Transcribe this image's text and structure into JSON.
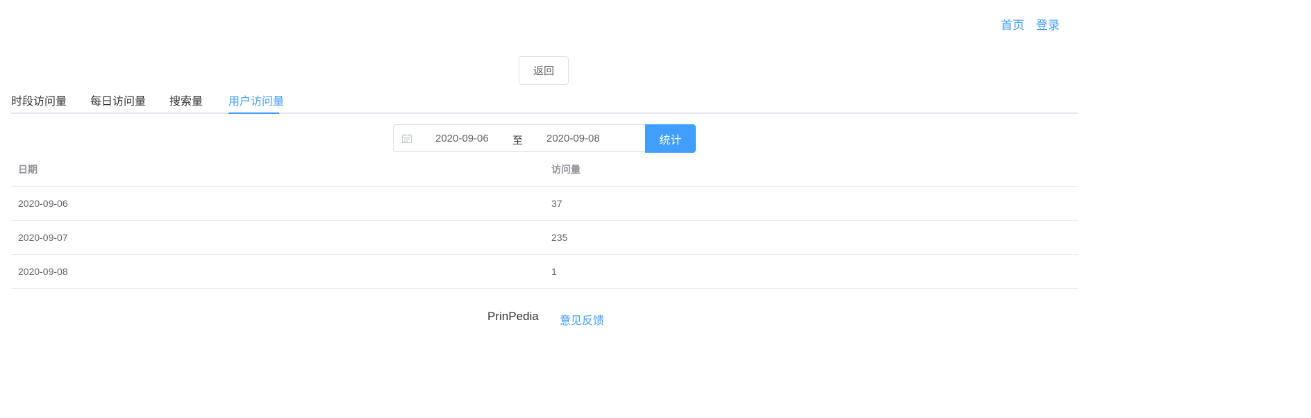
{
  "topnav": {
    "home": "首页",
    "login": "登录"
  },
  "back_button": "返回",
  "tabs": [
    {
      "label": "时段访问量",
      "active": false
    },
    {
      "label": "每日访问量",
      "active": false
    },
    {
      "label": "搜索量",
      "active": false
    },
    {
      "label": "用户访问量",
      "active": true
    }
  ],
  "date_range": {
    "icon": "calendar-icon",
    "start": "2020-09-06",
    "separator": "至",
    "end": "2020-09-08"
  },
  "stat_button": "统计",
  "table": {
    "headers": [
      "日期",
      "访问量"
    ],
    "rows": [
      [
        "2020-09-06",
        "37"
      ],
      [
        "2020-09-07",
        "235"
      ],
      [
        "2020-09-08",
        "1"
      ]
    ]
  },
  "footer": {
    "brand": "PrinPedia",
    "feedback": "意见反馈"
  },
  "colors": {
    "accent": "#409eff",
    "border": "#dcdfe6",
    "text": "#606266",
    "header_text": "#909399"
  }
}
